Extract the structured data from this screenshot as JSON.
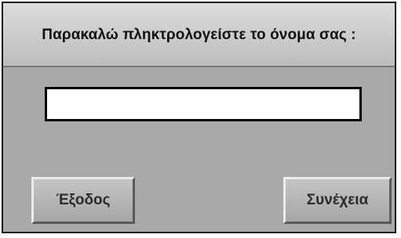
{
  "dialog": {
    "prompt": "Παρακαλώ πληκτρολογείστε το όνομα σας :",
    "name_input": {
      "value": "",
      "placeholder": ""
    },
    "buttons": {
      "exit_label": "Έξοδος",
      "continue_label": "Συνέχεια"
    }
  },
  "colors": {
    "dialog_background": "#a9a9a9",
    "title_background": "#cfcfcf",
    "input_background": "#ffffff",
    "border": "#000000"
  }
}
